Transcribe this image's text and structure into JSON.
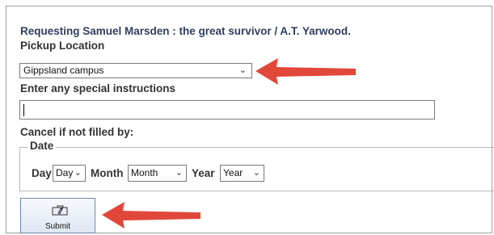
{
  "form": {
    "title": "Requesting Samuel Marsden : the great survivor / A.T. Yarwood.",
    "pickup_label": "Pickup Location",
    "pickup_value": "Gippsland campus",
    "special_label": "Enter any special instructions",
    "special_value": "",
    "cancel_label": "Cancel if not filled by:",
    "date_legend": "Date",
    "day_label": "Day",
    "day_value": "Day",
    "month_label": "Month",
    "month_value": "Month",
    "year_label": "Year",
    "year_value": "Year",
    "submit_label": "Submit"
  },
  "icons": {
    "select_chevron": "chevron-down-icon",
    "submit_icon": "submit-icon",
    "annotation_arrow": "arrow-left-icon"
  },
  "colors": {
    "annotation_arrow": "#e1483a",
    "title_text": "#2f3f5f",
    "button_border": "#6f87b1"
  }
}
